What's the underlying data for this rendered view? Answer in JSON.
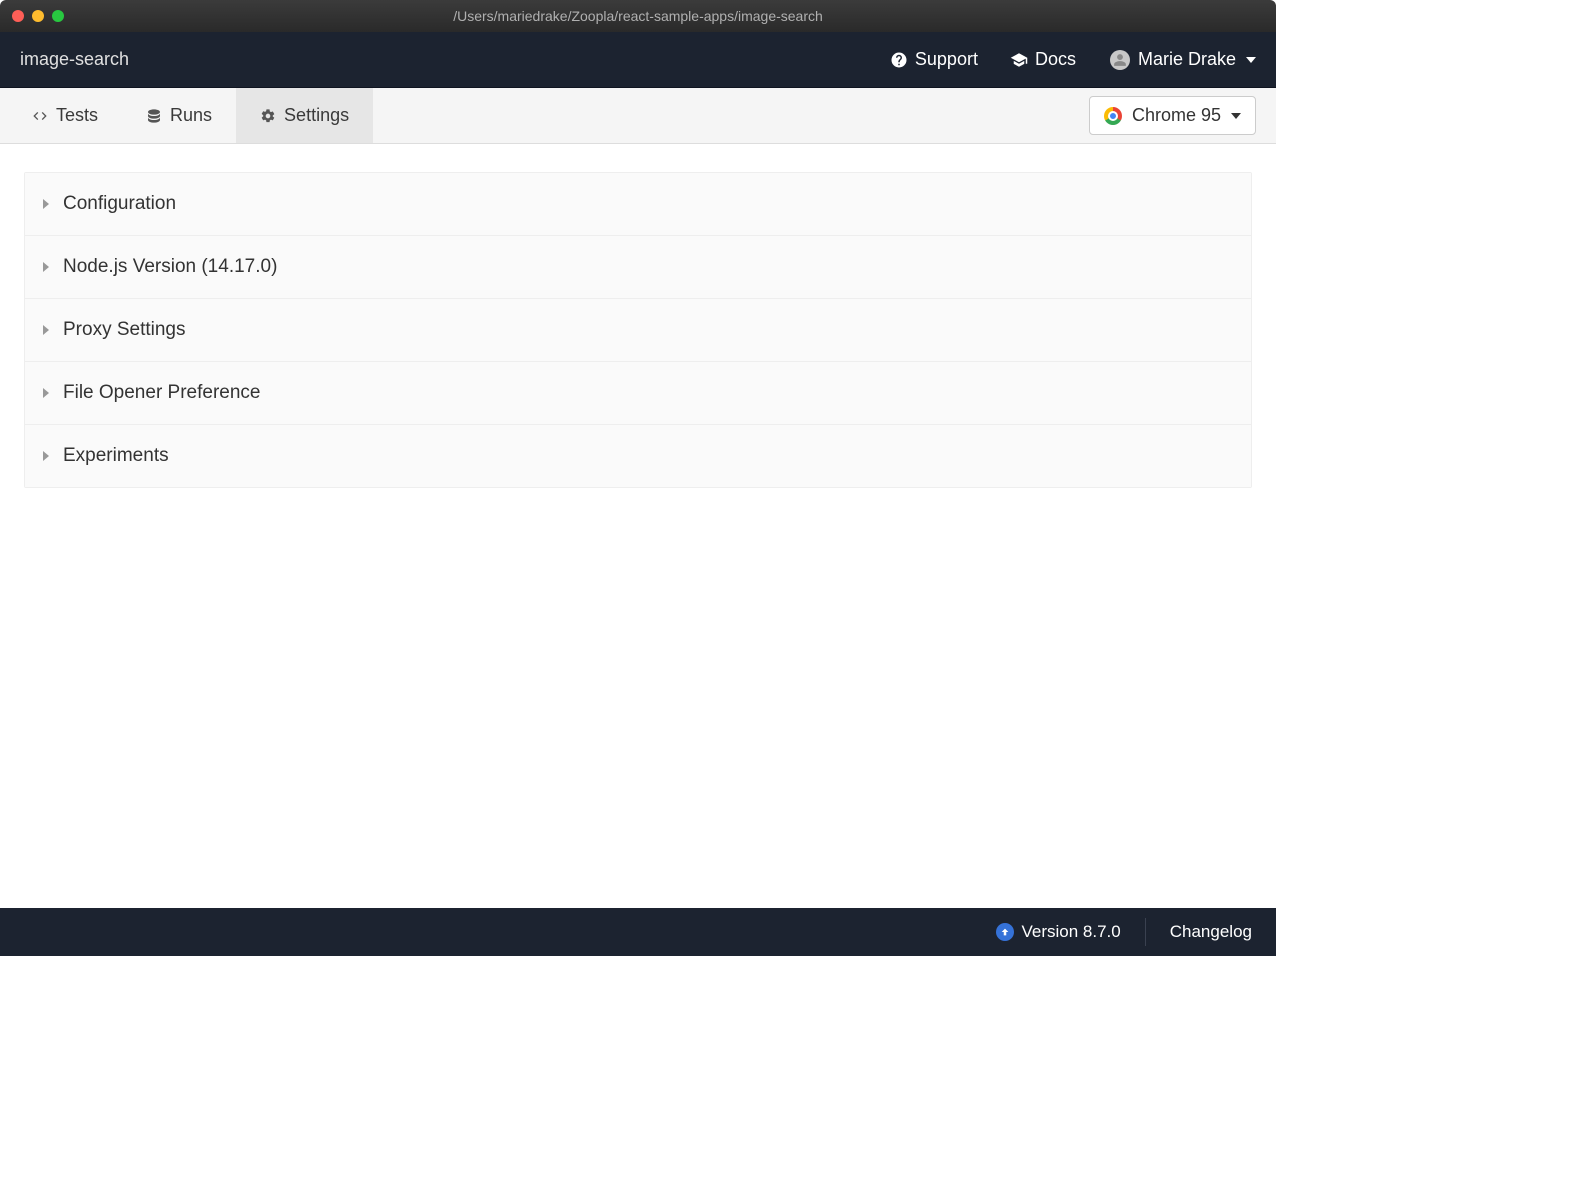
{
  "window": {
    "path": "/Users/mariedrake/Zoopla/react-sample-apps/image-search"
  },
  "header": {
    "project": "image-search",
    "support": "Support",
    "docs": "Docs",
    "user": "Marie Drake"
  },
  "tabs": {
    "tests": "Tests",
    "runs": "Runs",
    "settings": "Settings"
  },
  "browser": {
    "selected": "Chrome 95"
  },
  "settings_panels": [
    {
      "label": "Configuration"
    },
    {
      "label": "Node.js Version (14.17.0)"
    },
    {
      "label": "Proxy Settings"
    },
    {
      "label": "File Opener Preference"
    },
    {
      "label": "Experiments"
    }
  ],
  "footer": {
    "version": "Version 8.7.0",
    "changelog": "Changelog"
  }
}
